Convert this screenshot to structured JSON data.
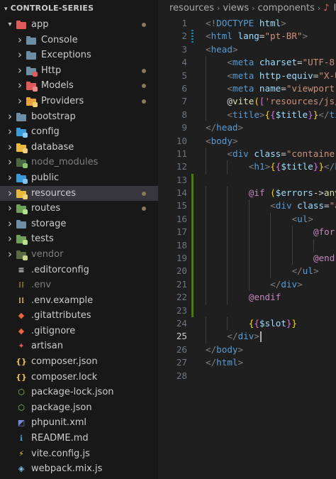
{
  "explorer": {
    "project_title": "CONTROLE-SERIES",
    "items": [
      {
        "label": "app",
        "depth": 0,
        "kind": "folder",
        "expanded": true,
        "icon": "folder-app-icon",
        "color": "#e05a5a",
        "badge": "",
        "dim": false,
        "dot": true,
        "selected": false,
        "chevron": true
      },
      {
        "label": "Console",
        "depth": 1,
        "kind": "folder",
        "expanded": false,
        "icon": "folder-icon",
        "color": "#6e8ea6",
        "badge": "",
        "dim": false,
        "dot": false,
        "selected": false,
        "chevron": true
      },
      {
        "label": "Exceptions",
        "depth": 1,
        "kind": "folder",
        "expanded": false,
        "icon": "folder-icon",
        "color": "#6e8ea6",
        "badge": "",
        "dim": false,
        "dot": false,
        "selected": false,
        "chevron": true
      },
      {
        "label": "Http",
        "depth": 1,
        "kind": "folder",
        "expanded": false,
        "icon": "folder-http-icon",
        "color": "#6e8ea6",
        "badge": "#e05a5a",
        "dim": false,
        "dot": true,
        "selected": false,
        "chevron": true
      },
      {
        "label": "Models",
        "depth": 1,
        "kind": "folder",
        "expanded": false,
        "icon": "folder-models-icon",
        "color": "#e05a5a",
        "badge": "#ef8b8b",
        "dim": false,
        "dot": true,
        "selected": false,
        "chevron": true
      },
      {
        "label": "Providers",
        "depth": 1,
        "kind": "folder",
        "expanded": false,
        "icon": "folder-providers-icon",
        "color": "#e8a33d",
        "badge": "#f7d26a",
        "dim": false,
        "dot": true,
        "selected": false,
        "chevron": true
      },
      {
        "label": "bootstrap",
        "depth": 0,
        "kind": "folder",
        "expanded": false,
        "icon": "folder-icon",
        "color": "#6e8ea6",
        "badge": "",
        "dim": false,
        "dot": false,
        "selected": false,
        "chevron": true
      },
      {
        "label": "config",
        "depth": 0,
        "kind": "folder",
        "expanded": false,
        "icon": "folder-config-icon",
        "color": "#3a9bd9",
        "badge": "#8fd0ff",
        "dim": false,
        "dot": false,
        "selected": false,
        "chevron": true
      },
      {
        "label": "database",
        "depth": 0,
        "kind": "folder",
        "expanded": false,
        "icon": "folder-database-icon",
        "color": "#e8b93d",
        "badge": "#f0d37a",
        "dim": false,
        "dot": false,
        "selected": false,
        "chevron": true
      },
      {
        "label": "node_modules",
        "depth": 0,
        "kind": "folder",
        "expanded": false,
        "icon": "folder-node-icon",
        "color": "#6ea05a",
        "badge": "#8cc46e",
        "dim": true,
        "dot": false,
        "selected": false,
        "chevron": true
      },
      {
        "label": "public",
        "depth": 0,
        "kind": "folder",
        "expanded": false,
        "icon": "folder-public-icon",
        "color": "#3a9bd9",
        "badge": "#7fc4f0",
        "dim": false,
        "dot": false,
        "selected": false,
        "chevron": true
      },
      {
        "label": "resources",
        "depth": 0,
        "kind": "folder",
        "expanded": false,
        "icon": "folder-resources-icon",
        "color": "#e8b93d",
        "badge": "#f0d37a",
        "dim": false,
        "dot": true,
        "selected": true,
        "chevron": true
      },
      {
        "label": "routes",
        "depth": 0,
        "kind": "folder",
        "expanded": false,
        "icon": "folder-routes-icon",
        "color": "#6ea05a",
        "badge": "#b6e08c",
        "dim": false,
        "dot": true,
        "selected": false,
        "chevron": true
      },
      {
        "label": "storage",
        "depth": 0,
        "kind": "folder",
        "expanded": false,
        "icon": "folder-icon",
        "color": "#6e8ea6",
        "badge": "",
        "dim": false,
        "dot": false,
        "selected": false,
        "chevron": true
      },
      {
        "label": "tests",
        "depth": 0,
        "kind": "folder",
        "expanded": false,
        "icon": "folder-tests-icon",
        "color": "#6ea05a",
        "badge": "#b6e08c",
        "dim": false,
        "dot": false,
        "selected": false,
        "chevron": true
      },
      {
        "label": "vendor",
        "depth": 0,
        "kind": "folder",
        "expanded": false,
        "icon": "folder-vendor-icon",
        "color": "#8aa060",
        "badge": "#c9d48a",
        "dim": true,
        "dot": false,
        "selected": false,
        "chevron": true
      },
      {
        "label": ".editorconfig",
        "depth": 0,
        "kind": "file",
        "icon": "editorconfig-icon",
        "glyph": "≡",
        "color": "#d9d9d9",
        "dim": false,
        "dot": false,
        "selected": false,
        "chevron": false
      },
      {
        "label": ".env",
        "depth": 0,
        "kind": "file",
        "icon": "env-icon",
        "glyph": "⁞⁞",
        "color": "#e8c43d",
        "dim": true,
        "dot": false,
        "selected": false,
        "chevron": false
      },
      {
        "label": ".env.example",
        "depth": 0,
        "kind": "file",
        "icon": "env-icon",
        "glyph": "⁞⁞",
        "color": "#e8c43d",
        "dim": false,
        "dot": false,
        "selected": false,
        "chevron": false
      },
      {
        "label": ".gitattributes",
        "depth": 0,
        "kind": "file",
        "icon": "git-icon",
        "glyph": "◆",
        "color": "#e8663d",
        "dim": false,
        "dot": false,
        "selected": false,
        "chevron": false
      },
      {
        "label": ".gitignore",
        "depth": 0,
        "kind": "file",
        "icon": "git-icon",
        "glyph": "◆",
        "color": "#e8663d",
        "dim": false,
        "dot": false,
        "selected": false,
        "chevron": false
      },
      {
        "label": "artisan",
        "depth": 0,
        "kind": "file",
        "icon": "laravel-icon",
        "glyph": "✦",
        "color": "#e05a5a",
        "dim": false,
        "dot": false,
        "selected": false,
        "chevron": false
      },
      {
        "label": "composer.json",
        "depth": 0,
        "kind": "file",
        "icon": "json-icon",
        "glyph": "{}",
        "color": "#e8c43d",
        "dim": false,
        "dot": false,
        "selected": false,
        "chevron": false
      },
      {
        "label": "composer.lock",
        "depth": 0,
        "kind": "file",
        "icon": "json-icon",
        "glyph": "{}",
        "color": "#e8c43d",
        "dim": false,
        "dot": false,
        "selected": false,
        "chevron": false
      },
      {
        "label": "package-lock.json",
        "depth": 0,
        "kind": "file",
        "icon": "nodejs-icon",
        "glyph": "⬡",
        "color": "#8cc46e",
        "dim": false,
        "dot": false,
        "selected": false,
        "chevron": false
      },
      {
        "label": "package.json",
        "depth": 0,
        "kind": "file",
        "icon": "nodejs-icon",
        "glyph": "⬡",
        "color": "#8cc46e",
        "dim": false,
        "dot": false,
        "selected": false,
        "chevron": false
      },
      {
        "label": "phpunit.xml",
        "depth": 0,
        "kind": "file",
        "icon": "phpunit-icon",
        "glyph": "◩",
        "color": "#7a86d9",
        "dim": false,
        "dot": false,
        "selected": false,
        "chevron": false
      },
      {
        "label": "README.md",
        "depth": 0,
        "kind": "file",
        "icon": "info-icon",
        "glyph": "ℹ",
        "color": "#3a9bd9",
        "dim": false,
        "dot": false,
        "selected": false,
        "chevron": false
      },
      {
        "label": "vite.config.js",
        "depth": 0,
        "kind": "file",
        "icon": "vite-icon",
        "glyph": "⚡",
        "color": "#e8c43d",
        "dim": false,
        "dot": false,
        "selected": false,
        "chevron": false
      },
      {
        "label": "webpack.mix.js",
        "depth": 0,
        "kind": "file",
        "icon": "webpack-icon",
        "glyph": "◈",
        "color": "#7fc4f0",
        "dim": false,
        "dot": false,
        "selected": false,
        "chevron": false
      }
    ]
  },
  "breadcrumb": {
    "parts": [
      "resources",
      "views",
      "components"
    ],
    "tail": "lay"
  },
  "editor": {
    "active_line": 25,
    "lines": [
      {
        "n": 1,
        "indent": 0,
        "git": "",
        "tokens": [
          [
            "br",
            "<!"
          ],
          [
            "tag",
            "DOCTYPE"
          ],
          [
            "txt",
            " "
          ],
          [
            "attr",
            "html"
          ],
          [
            "br",
            ">"
          ]
        ]
      },
      {
        "n": 2,
        "indent": 0,
        "git": "mod",
        "tokens": [
          [
            "br",
            "<"
          ],
          [
            "tag",
            "html"
          ],
          [
            "txt",
            " "
          ],
          [
            "attr",
            "lang"
          ],
          [
            "txt",
            "="
          ],
          [
            "str",
            "\"pt-BR\""
          ],
          [
            "br",
            ">"
          ]
        ]
      },
      {
        "n": 3,
        "indent": 0,
        "git": "",
        "tokens": [
          [
            "br",
            "<"
          ],
          [
            "tag",
            "head"
          ],
          [
            "br",
            ">"
          ]
        ]
      },
      {
        "n": 4,
        "indent": 1,
        "git": "",
        "tokens": [
          [
            "br",
            "<"
          ],
          [
            "tag",
            "meta"
          ],
          [
            "txt",
            " "
          ],
          [
            "attr",
            "charset"
          ],
          [
            "txt",
            "="
          ],
          [
            "str",
            "\"UTF-8\""
          ]
        ]
      },
      {
        "n": 5,
        "indent": 1,
        "git": "",
        "tokens": [
          [
            "br",
            "<"
          ],
          [
            "tag",
            "meta"
          ],
          [
            "txt",
            " "
          ],
          [
            "attr",
            "http-equiv"
          ],
          [
            "txt",
            "="
          ],
          [
            "str",
            "\"X-U"
          ]
        ]
      },
      {
        "n": 6,
        "indent": 1,
        "git": "",
        "tokens": [
          [
            "br",
            "<"
          ],
          [
            "tag",
            "meta"
          ],
          [
            "txt",
            " "
          ],
          [
            "attr",
            "name"
          ],
          [
            "txt",
            "="
          ],
          [
            "str",
            "\"viewport\""
          ]
        ]
      },
      {
        "n": 7,
        "indent": 1,
        "git": "",
        "tokens": [
          [
            "txt",
            "@"
          ],
          [
            "fn",
            "vite"
          ],
          [
            "p1",
            "("
          ],
          [
            "p2",
            "["
          ],
          [
            "str",
            "'resources/js/"
          ]
        ]
      },
      {
        "n": 8,
        "indent": 1,
        "git": "",
        "tokens": [
          [
            "br",
            "<"
          ],
          [
            "tag",
            "title"
          ],
          [
            "br",
            ">"
          ],
          [
            "p1",
            "{"
          ],
          [
            "p2",
            "{"
          ],
          [
            "var",
            "$title"
          ],
          [
            "p2",
            "}"
          ],
          [
            "p1",
            "}"
          ],
          [
            "br",
            "</"
          ],
          [
            "tag",
            "ti"
          ]
        ]
      },
      {
        "n": 9,
        "indent": 0,
        "git": "",
        "tokens": [
          [
            "br",
            "</"
          ],
          [
            "tag",
            "head"
          ],
          [
            "br",
            ">"
          ]
        ]
      },
      {
        "n": 10,
        "indent": 0,
        "git": "",
        "tokens": [
          [
            "br",
            "<"
          ],
          [
            "tag",
            "body"
          ],
          [
            "br",
            ">"
          ]
        ]
      },
      {
        "n": 11,
        "indent": 1,
        "git": "",
        "tokens": [
          [
            "br",
            "<"
          ],
          [
            "tag",
            "div"
          ],
          [
            "txt",
            " "
          ],
          [
            "attr",
            "class"
          ],
          [
            "txt",
            "="
          ],
          [
            "str",
            "\"container"
          ]
        ]
      },
      {
        "n": 12,
        "indent": 2,
        "git": "",
        "tokens": [
          [
            "br",
            "<"
          ],
          [
            "tag",
            "h1"
          ],
          [
            "br",
            ">"
          ],
          [
            "p1",
            "{"
          ],
          [
            "p2",
            "{"
          ],
          [
            "var",
            "$title"
          ],
          [
            "p2",
            "}"
          ],
          [
            "p1",
            "}"
          ],
          [
            "br",
            "</"
          ],
          [
            "tag",
            "h"
          ]
        ]
      },
      {
        "n": 13,
        "indent": 0,
        "git": "add",
        "tokens": []
      },
      {
        "n": 14,
        "indent": 2,
        "git": "add",
        "tokens": [
          [
            "dir",
            "@if"
          ],
          [
            "txt",
            " "
          ],
          [
            "p1",
            "("
          ],
          [
            "var",
            "$errors"
          ],
          [
            "txt",
            "->"
          ],
          [
            "fn",
            "any"
          ]
        ]
      },
      {
        "n": 15,
        "indent": 3,
        "git": "add",
        "tokens": [
          [
            "br",
            "<"
          ],
          [
            "tag",
            "div"
          ],
          [
            "txt",
            " "
          ],
          [
            "attr",
            "class"
          ],
          [
            "txt",
            "="
          ],
          [
            "str",
            "\"a"
          ]
        ]
      },
      {
        "n": 16,
        "indent": 4,
        "git": "add",
        "tokens": [
          [
            "br",
            "<"
          ],
          [
            "tag",
            "ul"
          ],
          [
            "br",
            ">"
          ]
        ]
      },
      {
        "n": 17,
        "indent": 5,
        "git": "add",
        "tokens": [
          [
            "dir",
            "@for"
          ]
        ]
      },
      {
        "n": 18,
        "indent": 6,
        "git": "add",
        "tokens": []
      },
      {
        "n": 19,
        "indent": 5,
        "git": "add",
        "tokens": [
          [
            "dir",
            "@end"
          ]
        ]
      },
      {
        "n": 20,
        "indent": 4,
        "git": "add",
        "tokens": [
          [
            "br",
            "</"
          ],
          [
            "tag",
            "ul"
          ],
          [
            "br",
            ">"
          ]
        ]
      },
      {
        "n": 21,
        "indent": 3,
        "git": "add",
        "tokens": [
          [
            "br",
            "</"
          ],
          [
            "tag",
            "div"
          ],
          [
            "br",
            ">"
          ]
        ]
      },
      {
        "n": 22,
        "indent": 2,
        "git": "add",
        "tokens": [
          [
            "dir",
            "@endif"
          ]
        ]
      },
      {
        "n": 23,
        "indent": 0,
        "git": "add",
        "tokens": []
      },
      {
        "n": 24,
        "indent": 2,
        "git": "",
        "tokens": [
          [
            "p1",
            "{"
          ],
          [
            "p2",
            "{"
          ],
          [
            "var",
            "$slot"
          ],
          [
            "p2",
            "}"
          ],
          [
            "p1",
            "}"
          ]
        ]
      },
      {
        "n": 25,
        "indent": 1,
        "git": "",
        "tokens": [
          [
            "br",
            "</"
          ],
          [
            "tag",
            "div"
          ],
          [
            "br",
            ">"
          ]
        ]
      },
      {
        "n": 26,
        "indent": 0,
        "git": "",
        "tokens": [
          [
            "br",
            "</"
          ],
          [
            "tag",
            "body"
          ],
          [
            "br",
            ">"
          ]
        ]
      },
      {
        "n": 27,
        "indent": 0,
        "git": "",
        "tokens": [
          [
            "br",
            "</"
          ],
          [
            "tag",
            "html"
          ],
          [
            "br",
            ">"
          ]
        ]
      },
      {
        "n": 28,
        "indent": 0,
        "git": "",
        "tokens": []
      }
    ]
  }
}
